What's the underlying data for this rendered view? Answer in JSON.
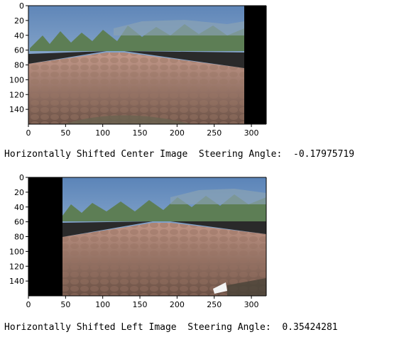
{
  "panels": [
    {
      "image_label": "center-camera-frame",
      "caption": "Horizontally Shifted Center Image  Steering Angle:  -0.17975719",
      "x_ticks": [
        "0",
        "50",
        "100",
        "150",
        "200",
        "250",
        "300"
      ],
      "y_ticks": [
        "0",
        "20",
        "40",
        "60",
        "80",
        "100",
        "120",
        "140"
      ],
      "shift": "left",
      "colors": {
        "sky_top": "#5f86b8",
        "sky_bottom": "#a9c3dc",
        "road": "#8a6a5c",
        "road_far": "#b08878",
        "shoulder": "#2b2b2b",
        "black": "#000000",
        "tree": "#5f7f52"
      }
    },
    {
      "image_label": "left-camera-frame",
      "caption": "Horizontally Shifted Left Image  Steering Angle:  0.35424281",
      "x_ticks": [
        "0",
        "50",
        "100",
        "150",
        "200",
        "250",
        "300"
      ],
      "y_ticks": [
        "0",
        "20",
        "40",
        "60",
        "80",
        "100",
        "120",
        "140"
      ],
      "shift": "right",
      "colors": {
        "sky_top": "#5f86b8",
        "sky_bottom": "#a9c3dc",
        "road": "#7f6457",
        "road_far": "#a98574",
        "shoulder": "#2b2b2b",
        "black": "#000000",
        "tree": "#5f7f52"
      }
    }
  ]
}
